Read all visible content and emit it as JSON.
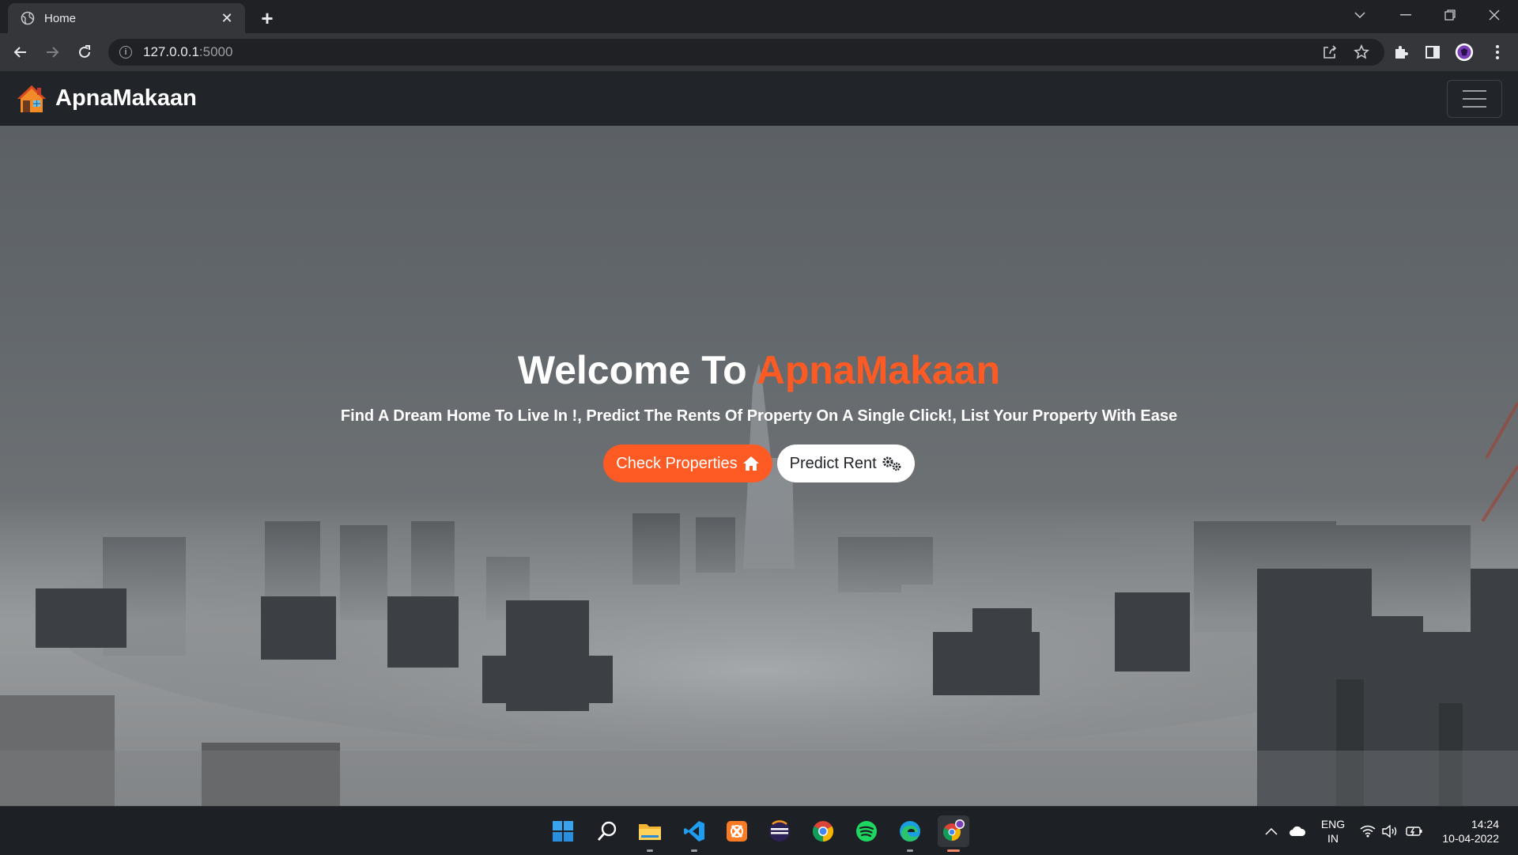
{
  "browser": {
    "tab_title": "Home",
    "url_host": "127.0.0.1",
    "url_port": ":5000"
  },
  "site": {
    "brand": "ApnaMakaan"
  },
  "hero": {
    "title_prefix": "Welcome To",
    "title_accent": "ApnaMakaan",
    "subtitle": "Find A Dream Home To Live In !, Predict The Rents Of Property On A Single Click!, List Your Property With Ease",
    "primary_button": "Check Properties",
    "secondary_button": "Predict Rent"
  },
  "taskbar": {
    "lang_primary": "ENG",
    "lang_secondary": "IN",
    "time": "14:24",
    "date": "10-04-2022"
  },
  "colors": {
    "accent": "#fd5a24",
    "navbar": "#212529"
  }
}
